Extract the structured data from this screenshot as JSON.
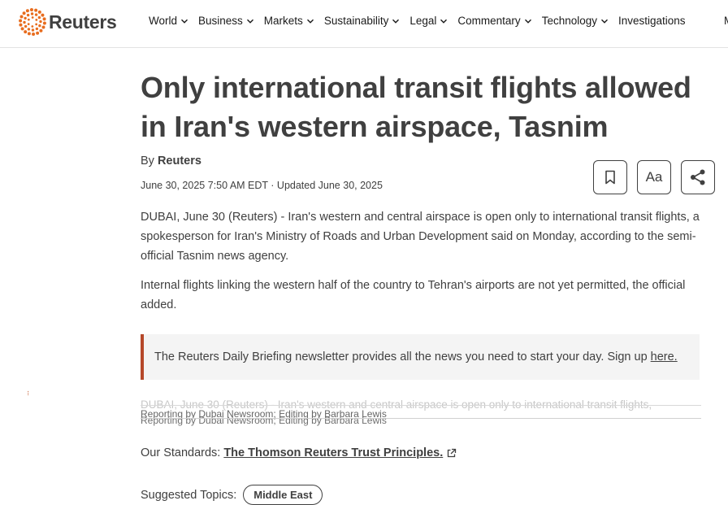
{
  "header": {
    "logo_text": "Reuters",
    "brand_color": "#e86d1f",
    "nav": [
      {
        "label": "World"
      },
      {
        "label": "Business"
      },
      {
        "label": "Markets"
      },
      {
        "label": "Sustainability"
      },
      {
        "label": "Legal"
      },
      {
        "label": "Commentary"
      },
      {
        "label": "Technology"
      }
    ],
    "nav_plain": "Investigations",
    "nav_cut": "M"
  },
  "article": {
    "headline": "Only international transit flights allowed in Iran's western airspace, Tasnim",
    "byline_prefix": "By",
    "byline_author": "Reuters",
    "dateline": "June 30, 2025 7:50 AM EDT · Updated June 30, 2025",
    "text_size_label": "Aa",
    "paragraphs": [
      "DUBAI, June 30 (Reuters) - Iran's western and central airspace is open only to international transit flights, a spokesperson for Iran's Ministry of Roads and Urban Development said on Monday, according to the semi-official Tasnim news agency.",
      "Internal flights linking the western half of the country to Tehran's airports are not yet permitted, the official added."
    ],
    "newsletter_text": "The Reuters Daily Briefing newsletter provides all the news you need to start your day. Sign up",
    "newsletter_link": "here.",
    "accent_color": "#b5482a",
    "ghost_line_1": "DUBAI, June 30 (Reuters) - Iran's western and central airspace is open only to international transit flights,",
    "ghost_line_2": "Reporting by Dubai Newsroom; Editing by Barbara Lewis",
    "ghost_line_3": "Reporting by Dubai Newsroom; Editing by Barbara Lewis",
    "standards_label": "Our Standards:",
    "standards_link": "The Thomson Reuters Trust Principles.",
    "topics_label": "Suggested Topics:",
    "topics": [
      "Middle East"
    ]
  }
}
